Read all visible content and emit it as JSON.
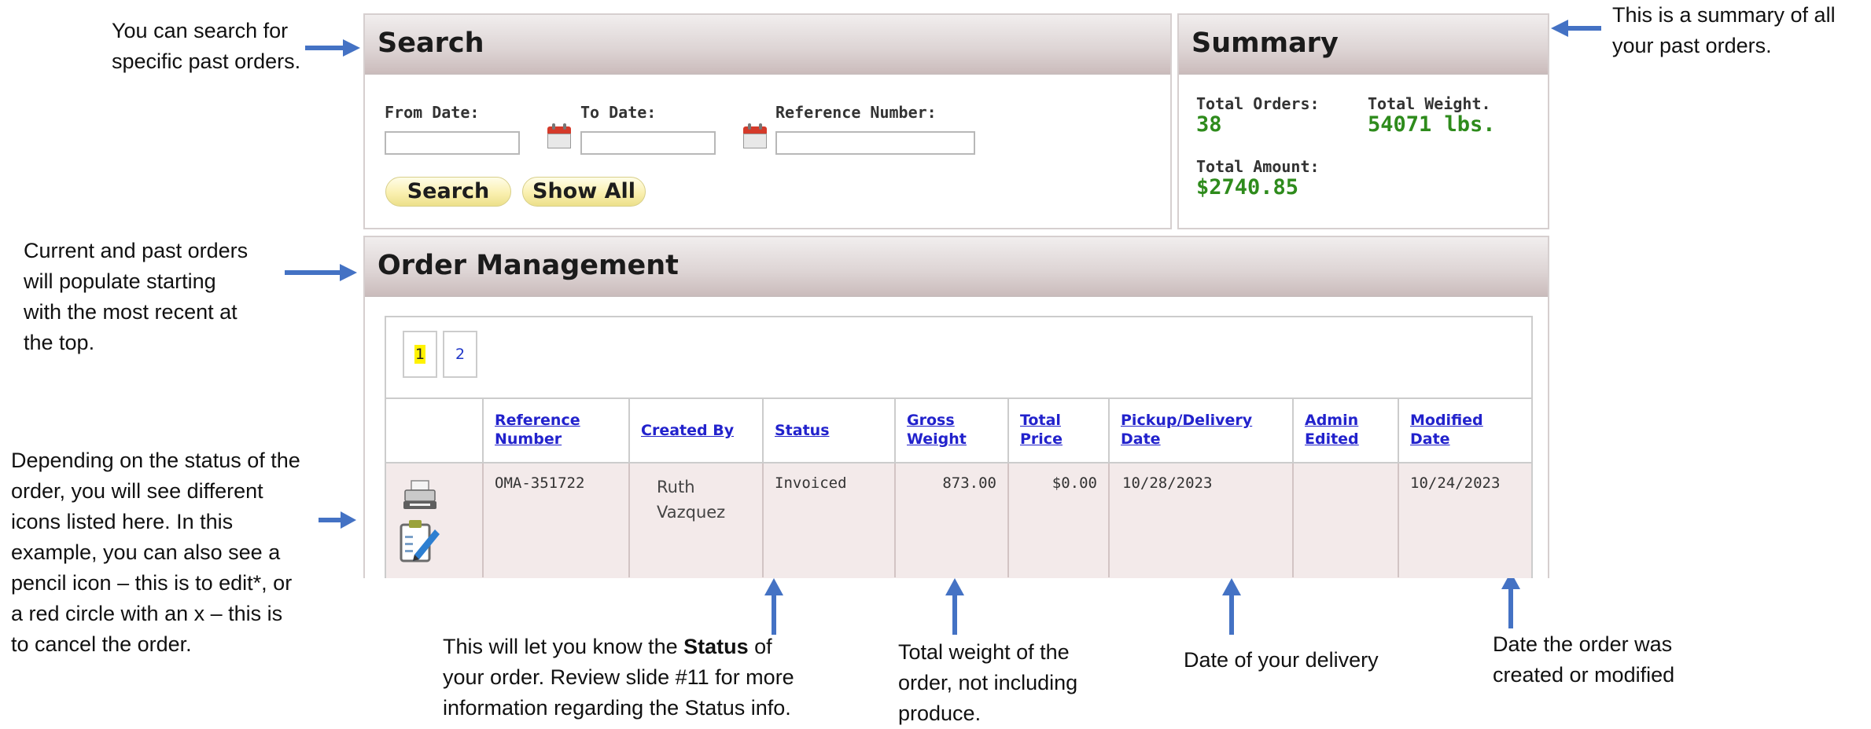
{
  "annotations": {
    "search_note": [
      "You can search for",
      "specific past orders."
    ],
    "summary_note": [
      "This is a summary of all",
      "your past orders."
    ],
    "orders_note": [
      "Current and past orders",
      "will populate starting",
      "with the most recent at",
      "the top."
    ],
    "icons_note": [
      "Depending on the status of the",
      "order, you will see different",
      "icons listed here. In this",
      "example, you can also see a",
      "pencil icon – this is to edit*, or",
      "a red circle with an x – this is",
      "to cancel the order."
    ],
    "status_note_pre": "This will let you know the ",
    "status_note_bold": "Status",
    "status_note_post": " of",
    "status_note_lines": [
      "your order. Review slide #11 for more",
      "information regarding the Status info."
    ],
    "weight_note": [
      "Total weight of the",
      "order, not including",
      "produce."
    ],
    "delivery_note": "Date of your delivery",
    "modified_note": [
      "Date the order was",
      "created or modified"
    ]
  },
  "search": {
    "title": "Search",
    "from_label": "From Date:",
    "to_label": "To Date:",
    "ref_label": "Reference Number:",
    "from_value": "",
    "to_value": "",
    "ref_value": "",
    "search_button": "Search",
    "show_all_button": "Show All"
  },
  "summary": {
    "title": "Summary",
    "total_orders_label": "Total Orders:",
    "total_orders_value": "38",
    "total_weight_label": "Total Weight.",
    "total_weight_value": "54071 lbs.",
    "total_amount_label": "Total Amount:",
    "total_amount_value": "$2740.85"
  },
  "orders": {
    "title": "Order Management",
    "pages": [
      "1",
      "2"
    ],
    "current_page": "1",
    "columns": [
      [
        "Reference",
        "Number"
      ],
      [
        "Created By"
      ],
      [
        "Status"
      ],
      [
        "Gross",
        "Weight"
      ],
      [
        "Total",
        "Price"
      ],
      [
        "Pickup/Delivery",
        "Date"
      ],
      [
        "Admin",
        "Edited"
      ],
      [
        "Modified",
        "Date"
      ]
    ],
    "rows": [
      {
        "reference": "OMA-351722",
        "created_by": [
          "Ruth",
          "Vazquez"
        ],
        "status": "Invoiced",
        "gross_weight": "873.00",
        "total_price": "$0.00",
        "pickup_date": "10/28/2023",
        "admin_edited": "",
        "modified_date": "10/24/2023"
      }
    ]
  },
  "colors": {
    "arrow": "#4472c4",
    "summary_value": "#2e8b1c",
    "link": "#2222cc",
    "row_bg": "#f3eaea"
  }
}
